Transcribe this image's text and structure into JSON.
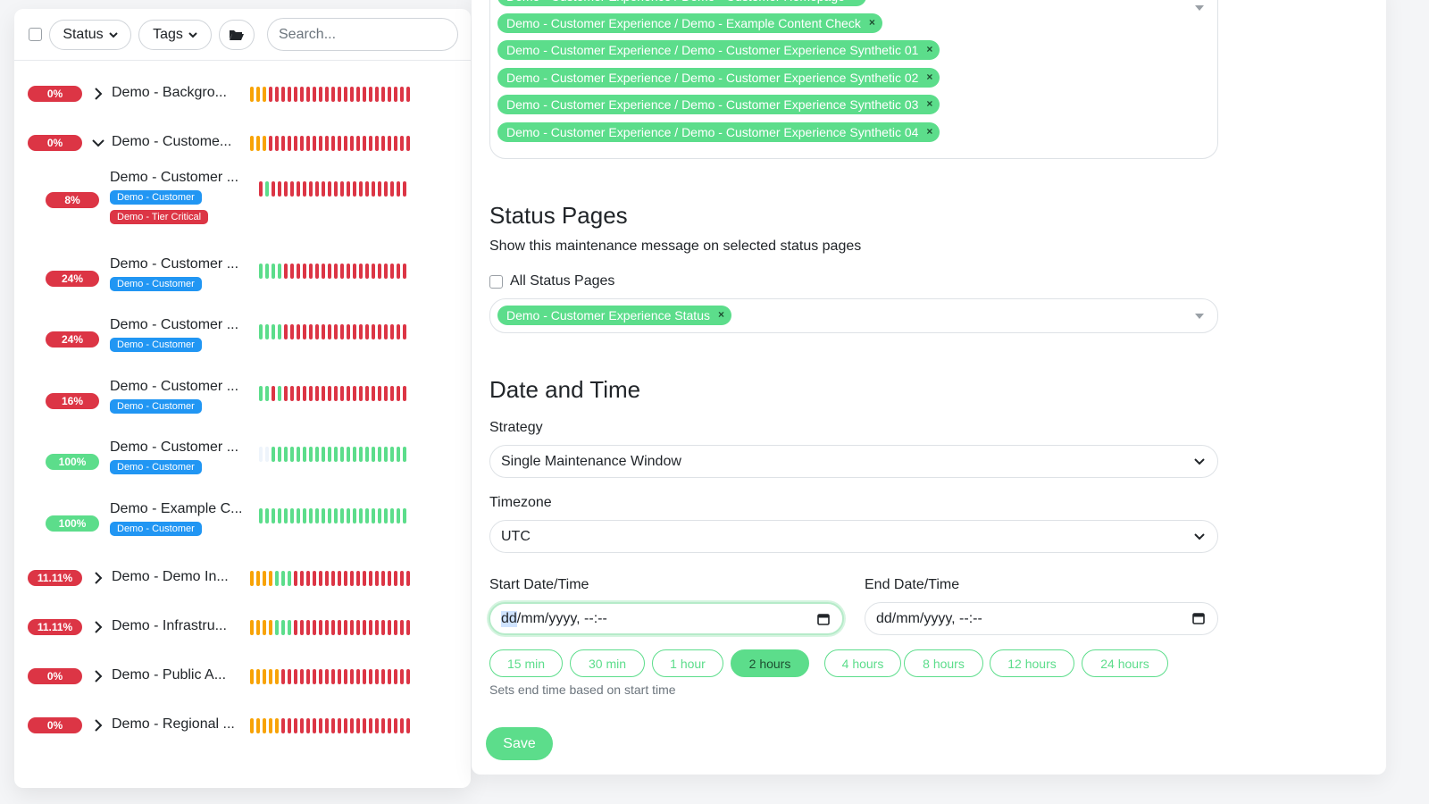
{
  "colors": {
    "accent_green": "#5cdd8b",
    "danger_red": "#dc3545",
    "warning_orange": "#f8a306",
    "tag_blue": "#2196f3"
  },
  "toolbar": {
    "status_label": "Status",
    "tags_label": "Tags",
    "folder_icon": "folder-open-icon",
    "search_placeholder": "Search..."
  },
  "monitors": [
    {
      "pct": "0%",
      "name": "Demo - Backgro...",
      "color": "red",
      "expander": "collapsed",
      "tags": [],
      "beats": "ooorrrrrrrrrrrrrrrrrrrrrr"
    },
    {
      "pct": "0%",
      "name": "Demo - Custome...",
      "color": "red",
      "expander": "expanded",
      "tags": [],
      "beats": "ooorrrrrrrrrrrrrrrrrrrrrr"
    },
    {
      "pct": "8%",
      "name": "Demo - Customer ...",
      "color": "red",
      "expander": "none",
      "tags": [
        {
          "label": "Demo - Customer",
          "color": "blue"
        },
        {
          "label": "Demo - Tier Critical",
          "color": "red"
        }
      ],
      "beats": "rgrrrrrrrrrrrrrrrrrrrrrrr"
    },
    {
      "pct": "24%",
      "name": "Demo - Customer ...",
      "color": "red",
      "expander": "none",
      "tags": [
        {
          "label": "Demo - Customer",
          "color": "blue"
        }
      ],
      "beats": "ggggrrrrrrrrrrrrrrrrrrrrr"
    },
    {
      "pct": "24%",
      "name": "Demo - Customer ...",
      "color": "red",
      "expander": "none",
      "tags": [
        {
          "label": "Demo - Customer",
          "color": "blue"
        }
      ],
      "beats": "ggggrrrrrrrrrrrrrrrrrrrrr"
    },
    {
      "pct": "16%",
      "name": "Demo - Customer ...",
      "color": "red",
      "expander": "none",
      "tags": [
        {
          "label": "Demo - Customer",
          "color": "blue"
        }
      ],
      "beats": "ggrgrrrrrrrrrrrrrrrrrrrrr"
    },
    {
      "pct": "100%",
      "name": "Demo - Customer ...",
      "color": "green",
      "expander": "none",
      "tags": [
        {
          "label": "Demo - Customer",
          "color": "blue"
        }
      ],
      "beats": "eeggggggggggggggggggggggg"
    },
    {
      "pct": "100%",
      "name": "Demo - Example C...",
      "color": "green",
      "expander": "none",
      "tags": [
        {
          "label": "Demo - Customer",
          "color": "blue"
        }
      ],
      "beats": "ggggggggggggggggggggggggg"
    },
    {
      "pct": "11.11%",
      "name": "Demo - Demo In...",
      "color": "red",
      "expander": "collapsed",
      "tags": [],
      "beats": "oooogggrrrrrrrrrrrrrrrrrr"
    },
    {
      "pct": "11.11%",
      "name": "Demo - Infrastru...",
      "color": "red",
      "expander": "collapsed",
      "tags": [],
      "beats": "oooogggrrrrrrrrrrrrrrrrrr"
    },
    {
      "pct": "0%",
      "name": "Demo - Public A...",
      "color": "red",
      "expander": "collapsed",
      "tags": [],
      "beats": "ooooorrrrrrrrrrrrrrrrrrrr"
    },
    {
      "pct": "0%",
      "name": "Demo - Regional ...",
      "color": "red",
      "expander": "collapsed",
      "tags": [],
      "beats": "ooooorrrrrrrrrrrrrrrrrrrr"
    }
  ],
  "affected_monitors": [
    "Demo - Customer Experience / Demo - Customer Homepage",
    "Demo - Customer Experience / Demo - Example Content Check",
    "Demo - Customer Experience / Demo - Customer Experience Synthetic 01",
    "Demo - Customer Experience / Demo - Customer Experience Synthetic 02",
    "Demo - Customer Experience / Demo - Customer Experience Synthetic 03",
    "Demo - Customer Experience / Demo - Customer Experience Synthetic 04"
  ],
  "status_pages": {
    "title": "Status Pages",
    "description": "Show this maintenance message on selected status pages",
    "all_label": "All Status Pages",
    "selected": [
      "Demo - Customer Experience Status"
    ]
  },
  "date_time": {
    "title": "Date and Time",
    "strategy_label": "Strategy",
    "strategy_value": "Single Maintenance Window",
    "timezone_label": "Timezone",
    "timezone_value": "UTC",
    "start_label": "Start Date/Time",
    "start_value_highlight": "dd",
    "start_value_rest": "/mm/yyyy, --:--",
    "end_label": "End Date/Time",
    "end_value": "dd/mm/yyyy, --:--",
    "quick_buttons": [
      "15 min",
      "30 min",
      "1 hour",
      "2 hours",
      "4 hours",
      "8 hours",
      "12 hours",
      "24 hours"
    ],
    "active_quick": "2 hours",
    "hint": "Sets end time based on start time"
  },
  "save_label": "Save"
}
